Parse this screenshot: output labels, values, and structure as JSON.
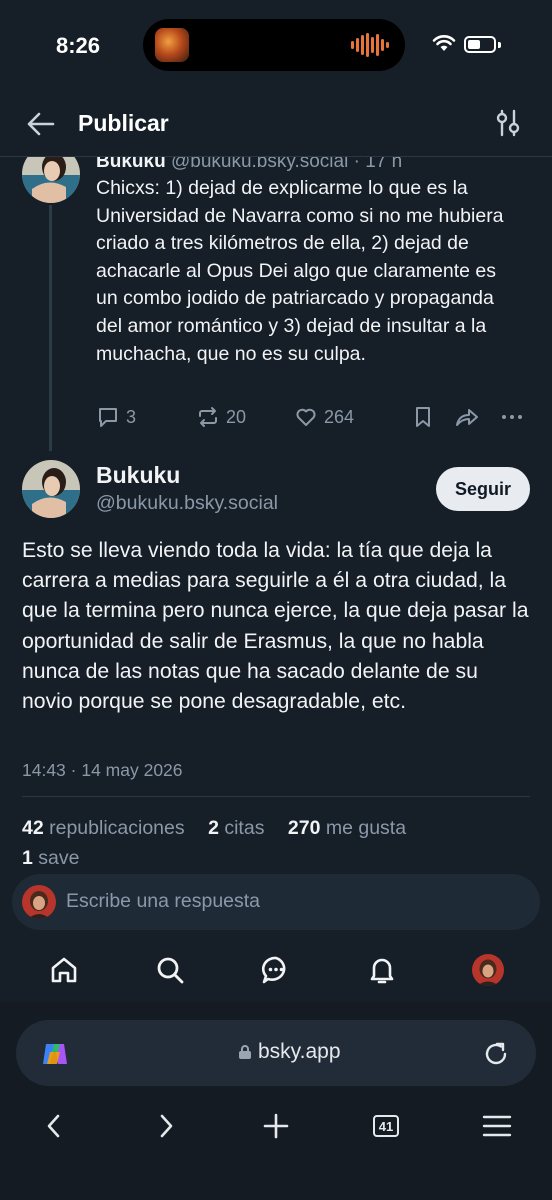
{
  "status_bar": {
    "time": "8:26"
  },
  "header": {
    "title": "Publicar"
  },
  "parent_post": {
    "author_name": "Bukuku",
    "author_handle": "@bukuku.bsky.social",
    "date": "· 17 h",
    "text": "Chicxs: 1) dejad de explicarme lo que es la Universidad de Navarra como si no me hubiera criado a tres kilómetros de ella, 2) dejad de achacarle al Opus Dei algo que claramente es un combo jodido de patriarcado y propaganda del amor romántico y 3) dejad de insultar a la muchacha, que no es su culpa.",
    "replies": "3",
    "reposts": "20",
    "likes": "264"
  },
  "main_post": {
    "author_name": "Bukuku",
    "author_handle": "@bukuku.bsky.social",
    "follow_label": "Seguir",
    "text": "Esto se lleva viendo toda la vida: la tía que deja la carrera a medias para seguirle a él a otra ciudad, la que la termina pero nunca ejerce, la que deja pasar la oportunidad de salir de Erasmus, la que no habla nunca de las notas que ha sacado delante de su novio porque se pone desagradable, etc.",
    "timestamp": "14:43 · 14 may 2026",
    "reposts_count": "42",
    "reposts_label": "republicaciones",
    "quotes_count": "2",
    "quotes_label": "citas",
    "likes_count": "270",
    "likes_label": "me gusta",
    "saves_count": "1",
    "saves_label": "save"
  },
  "composer": {
    "placeholder": "Escribe una respuesta"
  },
  "browser": {
    "url": "bsky.app",
    "tab_count": "41"
  },
  "colors": {
    "background": "#161e27",
    "muted_text": "#8a98a8",
    "primary_text": "#f1f3f5",
    "follow_button_bg": "#e8ecf1"
  },
  "icons": [
    "back-arrow-icon",
    "sliders-icon",
    "reply-icon",
    "repost-icon",
    "heart-icon",
    "bookmark-icon",
    "share-icon",
    "more-icon",
    "home-icon",
    "search-icon",
    "chat-icon",
    "bell-icon",
    "lock-icon",
    "reload-icon",
    "copilot-icon"
  ]
}
